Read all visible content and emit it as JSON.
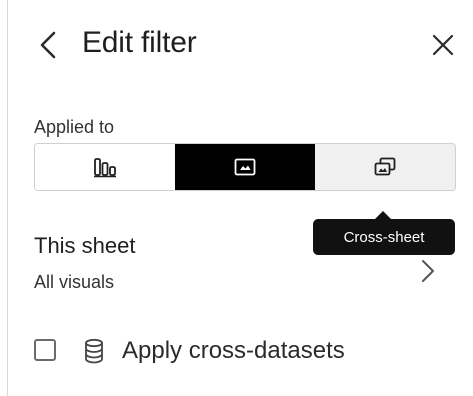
{
  "header": {
    "title": "Edit filter",
    "back_icon": "chevron-left-icon",
    "close_icon": "close-icon"
  },
  "applied_to": {
    "label": "Applied to",
    "options": [
      {
        "icon": "bar-chart-icon",
        "selected": false
      },
      {
        "icon": "single-visual-icon",
        "selected": true
      },
      {
        "icon": "cross-sheet-icon",
        "selected": false,
        "hovered": true
      }
    ],
    "tooltip": "Cross-sheet"
  },
  "scope": {
    "title": "This sheet",
    "subtitle": "All visuals",
    "chevron_icon": "chevron-right-icon"
  },
  "cross_datasets": {
    "checked": false,
    "icon": "database-icon",
    "label": "Apply cross-datasets"
  },
  "colors": {
    "selected_bg": "#000000",
    "hover_bg": "#f0f0f0",
    "tooltip_bg": "#111111",
    "text": "#1f1f1f"
  }
}
